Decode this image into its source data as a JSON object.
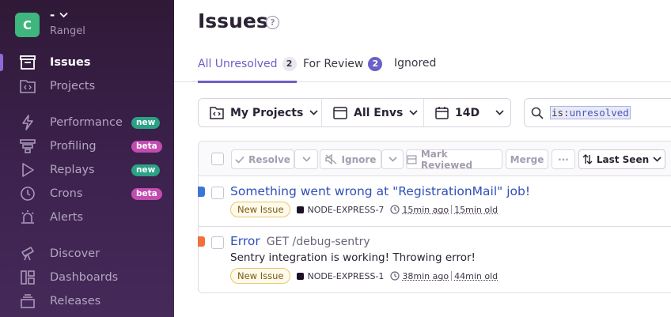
{
  "org": {
    "initial": "C",
    "name": "-",
    "user": "Rangel"
  },
  "nav": {
    "issues": "Issues",
    "projects": "Projects",
    "performance": "Performance",
    "profiling": "Profiling",
    "replays": "Replays",
    "crons": "Crons",
    "alerts": "Alerts",
    "discover": "Discover",
    "dashboards": "Dashboards",
    "releases": "Releases",
    "badge_new": "new",
    "badge_beta": "beta"
  },
  "page": {
    "title": "Issues",
    "help": "?"
  },
  "tabs": {
    "unresolved": {
      "label": "All Unresolved",
      "count": "2"
    },
    "review": {
      "label": "For Review",
      "count": "2"
    },
    "ignored": {
      "label": "Ignored"
    }
  },
  "filters": {
    "projects": "My Projects",
    "envs": "All Envs",
    "period": "14D"
  },
  "search": {
    "key": "is:",
    "value": "unresolved"
  },
  "actions": {
    "resolve": "Resolve",
    "ignore": "Ignore",
    "mark_reviewed": "Mark Reviewed",
    "merge": "Merge",
    "more": "···",
    "sort": "Last Seen"
  },
  "issues": [
    {
      "title": "Something went wrong at \"RegistrationMail\" job!",
      "location": "",
      "message": "",
      "status": "New Issue",
      "project": "NODE-EXPRESS-7",
      "last_seen": "15min ago",
      "age": "15min old",
      "level_color": "#3d74db"
    },
    {
      "title": "Error",
      "location": "GET /debug-sentry",
      "message": "Sentry integration is working! Throwing error!",
      "status": "New Issue",
      "project": "NODE-EXPRESS-1",
      "last_seen": "38min ago",
      "age": "44min old",
      "level_color": "#f2713a"
    }
  ],
  "colors": {
    "accent": "#6c5fc7",
    "sidebar_bg": "#2f1937",
    "link": "#2f4fb8"
  }
}
